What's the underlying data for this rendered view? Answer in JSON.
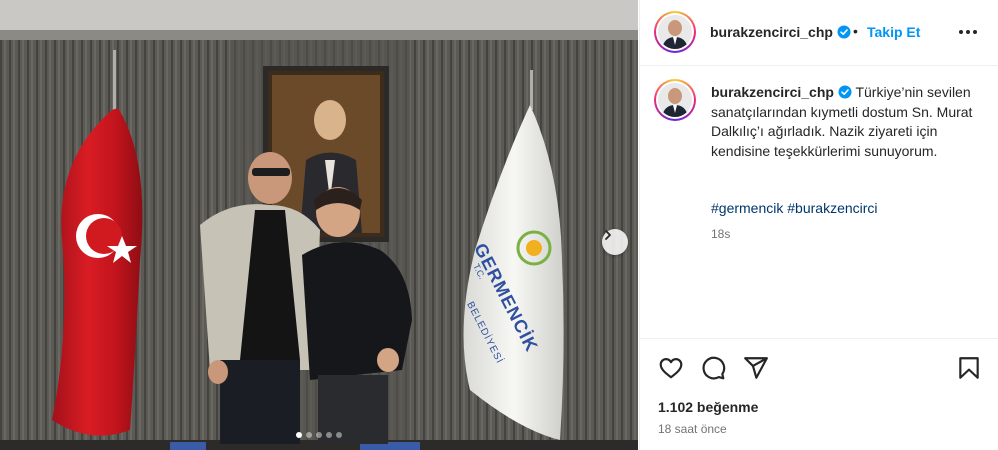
{
  "post": {
    "username": "burakzencirci_chp",
    "follow_label": "Takip Et",
    "separator": "•",
    "caption": "Türkiye’nin sevilen sanatçılarından kıymetli dostum Sn. Murat Dalkılıç’ı ağırladık. Nazik ziyareti için kendisine teşekkürlerimi sunuyorum.",
    "hashtags": [
      "#germencik",
      "#burakzencirci"
    ],
    "comment_time": "18s",
    "likes": "1.102 beğenme",
    "posted_ago": "18 saat önce"
  },
  "photo": {
    "flag_text": {
      "tc": "T.C.",
      "name": "GERMENCİK",
      "sub": "BELEDİYESİ"
    },
    "carousel": {
      "total": 5,
      "active": 1
    }
  },
  "icons": {
    "more": "more-options-icon",
    "verified": "verified-badge-icon",
    "like": "heart-icon",
    "comment": "comment-bubble-icon",
    "share": "send-icon",
    "save": "bookmark-icon",
    "next": "chevron-right-icon"
  },
  "colors": {
    "follow_blue": "#0095f6",
    "verified_blue": "#0095f6",
    "hashtag": "#00376b",
    "flag_red": "#d11a20"
  }
}
